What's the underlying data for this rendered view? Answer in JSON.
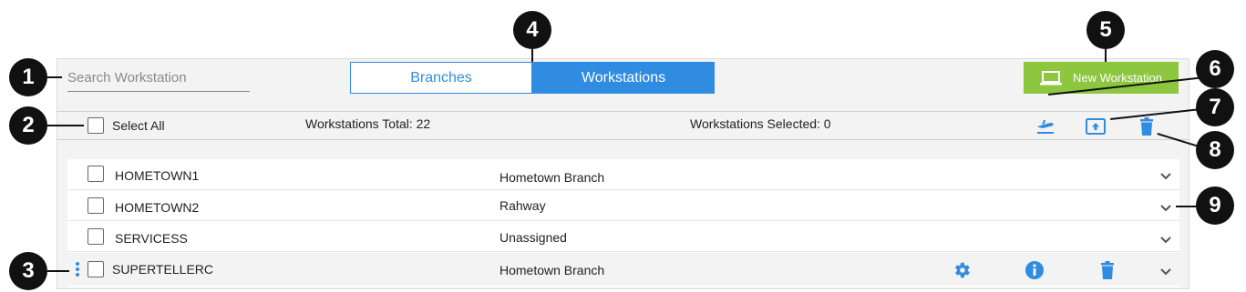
{
  "search": {
    "placeholder": "Search Workstation"
  },
  "tabs": [
    {
      "label": "Branches",
      "active": false
    },
    {
      "label": "Workstations",
      "active": true
    }
  ],
  "new_button": {
    "label": "New Workstation",
    "icon": "laptop-icon"
  },
  "toolbar": {
    "select_all_label": "Select All",
    "total_label": "Workstations Total: 22",
    "selected_label": "Workstations Selected: 0",
    "actions": [
      {
        "icon": "deploy-icon"
      },
      {
        "icon": "upload-icon"
      },
      {
        "icon": "trash-icon"
      }
    ]
  },
  "rows": [
    {
      "name": "HOMETOWN1",
      "branch": "Hometown Branch",
      "hover": false
    },
    {
      "name": "HOMETOWN2",
      "branch": "Rahway",
      "hover": false
    },
    {
      "name": "SERVICESS",
      "branch": "Unassigned",
      "hover": false
    },
    {
      "name": "SUPERTELLERC",
      "branch": "Hometown Branch",
      "hover": true,
      "row_actions": [
        {
          "icon": "gear-icon"
        },
        {
          "icon": "info-icon"
        },
        {
          "icon": "trash-icon"
        }
      ]
    }
  ],
  "callouts": [
    "1",
    "2",
    "3",
    "4",
    "5",
    "6",
    "7",
    "8",
    "9"
  ],
  "colors": {
    "accent": "#2f8ce0",
    "success": "#8dc63f",
    "callout": "#111111"
  }
}
